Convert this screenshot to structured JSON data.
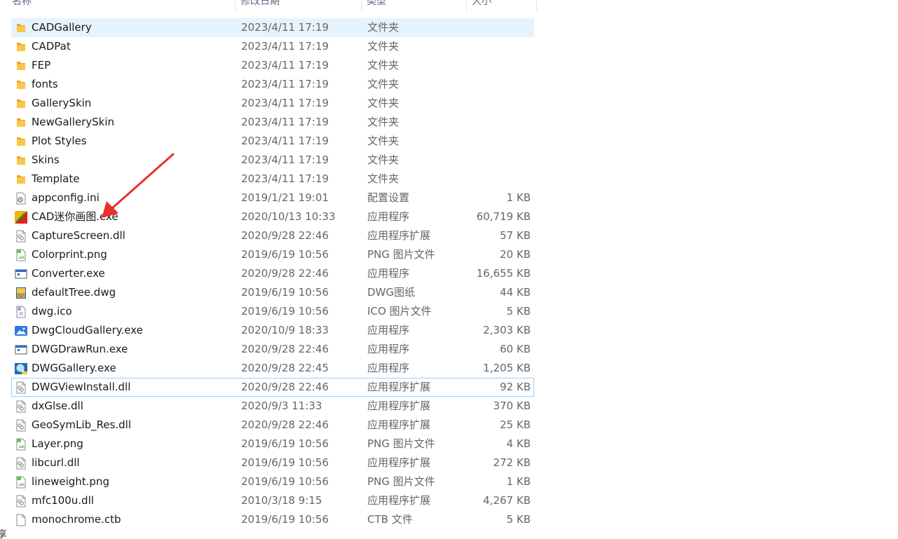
{
  "columns": {
    "name": "名称",
    "date": "修改日期",
    "type": "类型",
    "size": "大小"
  },
  "files": [
    {
      "name": "CADGallery",
      "date": "2023/4/11 17:19",
      "type": "文件夹",
      "size": "",
      "icon": "folder-icon"
    },
    {
      "name": "CADPat",
      "date": "2023/4/11 17:19",
      "type": "文件夹",
      "size": "",
      "icon": "folder-icon"
    },
    {
      "name": "FEP",
      "date": "2023/4/11 17:19",
      "type": "文件夹",
      "size": "",
      "icon": "folder-icon"
    },
    {
      "name": "fonts",
      "date": "2023/4/11 17:19",
      "type": "文件夹",
      "size": "",
      "icon": "folder-icon"
    },
    {
      "name": "GallerySkin",
      "date": "2023/4/11 17:19",
      "type": "文件夹",
      "size": "",
      "icon": "folder-icon"
    },
    {
      "name": "NewGallerySkin",
      "date": "2023/4/11 17:19",
      "type": "文件夹",
      "size": "",
      "icon": "folder-icon"
    },
    {
      "name": "Plot Styles",
      "date": "2023/4/11 17:19",
      "type": "文件夹",
      "size": "",
      "icon": "folder-icon"
    },
    {
      "name": "Skins",
      "date": "2023/4/11 17:19",
      "type": "文件夹",
      "size": "",
      "icon": "folder-icon"
    },
    {
      "name": "Template",
      "date": "2023/4/11 17:19",
      "type": "文件夹",
      "size": "",
      "icon": "folder-icon"
    },
    {
      "name": "appconfig.ini",
      "date": "2019/1/21 19:01",
      "type": "配置设置",
      "size": "1 KB",
      "icon": "ini-file-icon"
    },
    {
      "name": "CAD迷你画图.exe",
      "date": "2020/10/13 10:33",
      "type": "应用程序",
      "size": "60,719 KB",
      "icon": "cad-app-icon"
    },
    {
      "name": "CaptureScreen.dll",
      "date": "2020/9/28 22:46",
      "type": "应用程序扩展",
      "size": "57 KB",
      "icon": "dll-file-icon"
    },
    {
      "name": "Colorprint.png",
      "date": "2019/6/19 10:56",
      "type": "PNG 图片文件",
      "size": "20 KB",
      "icon": "png-file-icon"
    },
    {
      "name": "Converter.exe",
      "date": "2020/9/28 22:46",
      "type": "应用程序",
      "size": "16,655 KB",
      "icon": "exe-window-icon"
    },
    {
      "name": "defaultTree.dwg",
      "date": "2019/6/19 10:56",
      "type": "DWG图纸",
      "size": "44 KB",
      "icon": "dwg-file-icon"
    },
    {
      "name": "dwg.ico",
      "date": "2019/6/19 10:56",
      "type": "ICO 图片文件",
      "size": "5 KB",
      "icon": "ico-file-icon"
    },
    {
      "name": "DwgCloudGallery.exe",
      "date": "2020/10/9 18:33",
      "type": "应用程序",
      "size": "2,303 KB",
      "icon": "picture-app-icon"
    },
    {
      "name": "DWGDrawRun.exe",
      "date": "2020/9/28 22:46",
      "type": "应用程序",
      "size": "60 KB",
      "icon": "exe-window-icon"
    },
    {
      "name": "DWGGallery.exe",
      "date": "2020/9/28 22:45",
      "type": "应用程序",
      "size": "1,205 KB",
      "icon": "gallery-app-icon"
    },
    {
      "name": "DWGViewInstall.dll",
      "date": "2020/9/28 22:46",
      "type": "应用程序扩展",
      "size": "92 KB",
      "icon": "dll-file-icon"
    },
    {
      "name": "dxGlse.dll",
      "date": "2020/9/3 11:33",
      "type": "应用程序扩展",
      "size": "370 KB",
      "icon": "dll-file-icon"
    },
    {
      "name": "GeoSymLib_Res.dll",
      "date": "2020/9/28 22:46",
      "type": "应用程序扩展",
      "size": "25 KB",
      "icon": "dll-file-icon"
    },
    {
      "name": "Layer.png",
      "date": "2019/6/19 10:56",
      "type": "PNG 图片文件",
      "size": "4 KB",
      "icon": "png-file-icon"
    },
    {
      "name": "libcurl.dll",
      "date": "2019/6/19 10:56",
      "type": "应用程序扩展",
      "size": "272 KB",
      "icon": "dll-file-icon"
    },
    {
      "name": "lineweight.png",
      "date": "2019/6/19 10:56",
      "type": "PNG 图片文件",
      "size": "1 KB",
      "icon": "png-file-icon"
    },
    {
      "name": "mfc100u.dll",
      "date": "2010/3/18 9:15",
      "type": "应用程序扩展",
      "size": "4,267 KB",
      "icon": "dll-file-icon"
    },
    {
      "name": "monochrome.ctb",
      "date": "2019/6/19 10:56",
      "type": "CTB 文件",
      "size": "5 KB",
      "icon": "blank-file-icon"
    }
  ],
  "selected_index": 0,
  "focused_index": 19,
  "corner_text": "享",
  "colors": {
    "selection": "#e5f3ff",
    "focus_border": "#99d1ff",
    "folder": "#f8c64a",
    "annotation_arrow": "#e8302a"
  }
}
